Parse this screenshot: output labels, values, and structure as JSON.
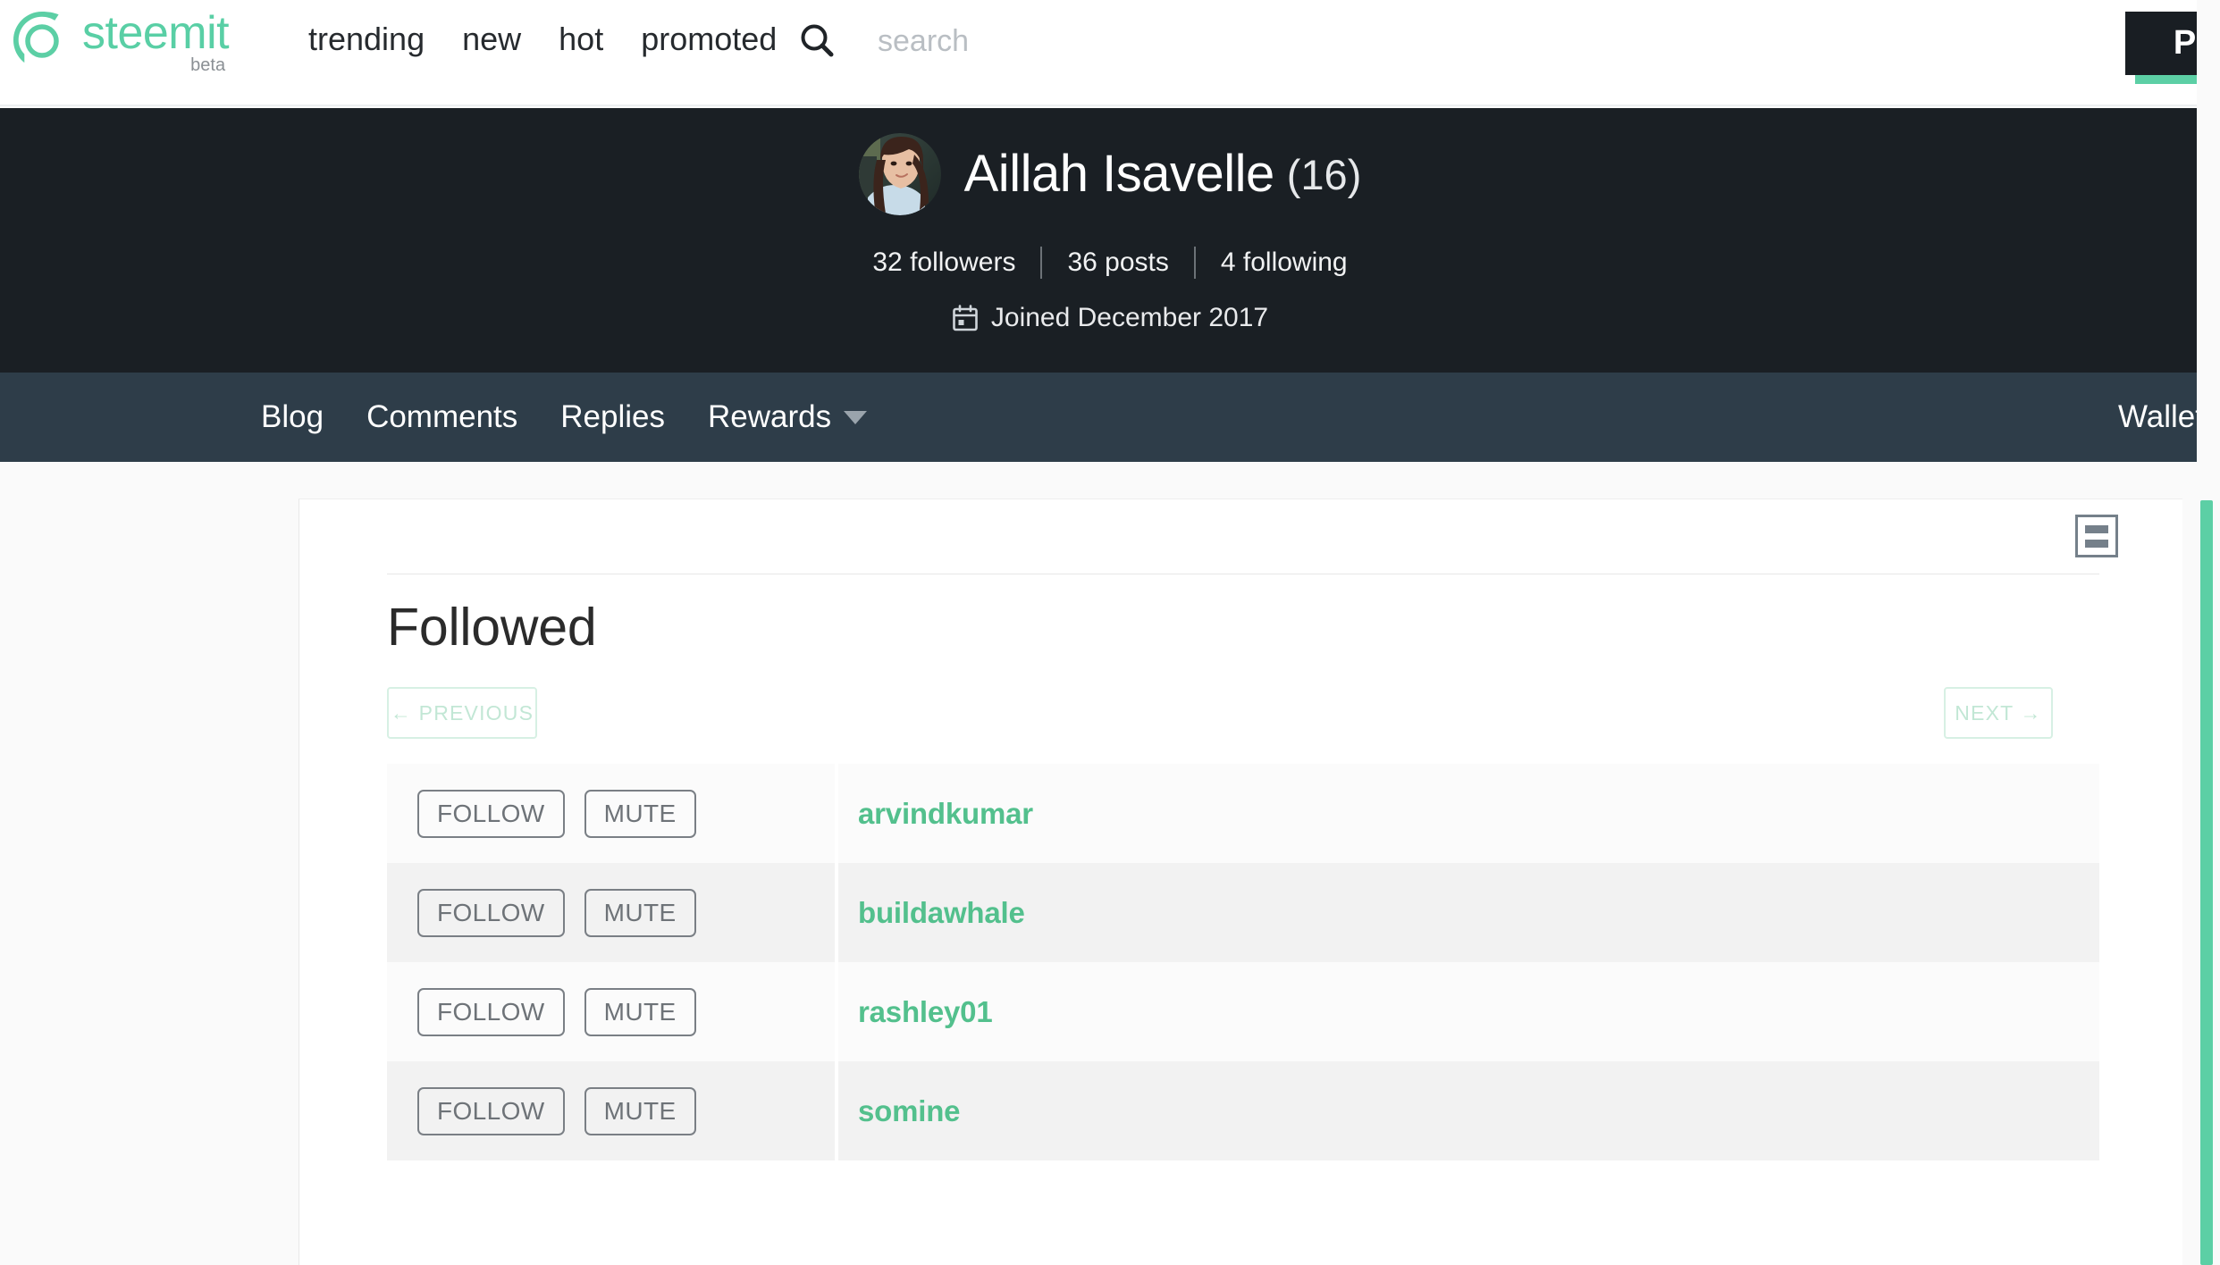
{
  "brand": {
    "name": "steemit",
    "beta": "beta",
    "logo_icon": "steemit-logo-icon"
  },
  "topnav": {
    "links": [
      {
        "label": "trending",
        "name": "nav-trending"
      },
      {
        "label": "new",
        "name": "nav-new"
      },
      {
        "label": "hot",
        "name": "nav-hot"
      },
      {
        "label": "promoted",
        "name": "nav-promoted"
      }
    ],
    "search": {
      "icon": "search-icon",
      "placeholder": "search",
      "value": ""
    },
    "post_button": "Post"
  },
  "profile": {
    "avatar_icon": "avatar",
    "display_name": "Aillah Isavelle",
    "reputation": "(16)",
    "stats": {
      "followers": "32 followers",
      "posts": "36 posts",
      "following": "4 following"
    },
    "joined_icon": "calendar-icon",
    "joined": "Joined December 2017"
  },
  "tabbar": {
    "tabs": [
      {
        "label": "Blog",
        "name": "tab-blog",
        "caret": false
      },
      {
        "label": "Comments",
        "name": "tab-comments",
        "caret": false
      },
      {
        "label": "Replies",
        "name": "tab-replies",
        "caret": false
      },
      {
        "label": "Rewards",
        "name": "tab-rewards",
        "caret": true
      }
    ],
    "wallet": "Wallet"
  },
  "card": {
    "menu_icon": "list-view-icon",
    "title": "Followed",
    "pagination": {
      "previous": "← PREVIOUS",
      "next": "NEXT →"
    },
    "row_actions": {
      "follow": "FOLLOW",
      "mute": "MUTE"
    },
    "rows": [
      {
        "username": "arvindkumar"
      },
      {
        "username": "buildawhale"
      },
      {
        "username": "rashley01"
      },
      {
        "username": "somine"
      }
    ]
  },
  "colors": {
    "accent_green": "#5ccfa5",
    "username_green": "#53c08d",
    "hero_bg": "#1a1f24",
    "tabbar_bg": "#2e3d49",
    "post_bg": "#191e23"
  }
}
